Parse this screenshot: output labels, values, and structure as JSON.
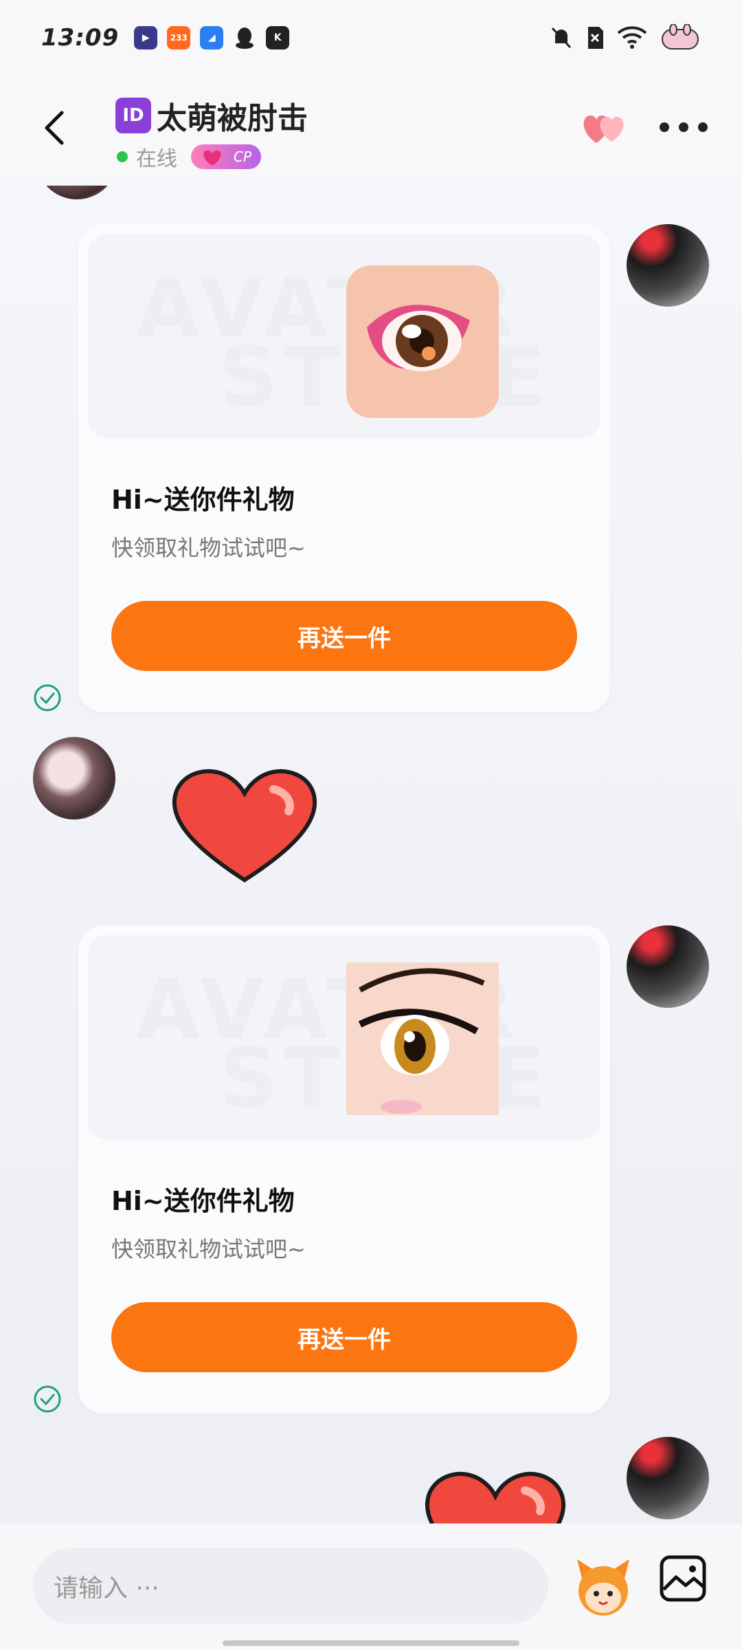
{
  "status": {
    "time": "13:09",
    "apps": [
      {
        "name": "app-icon-1",
        "label": "▶",
        "color": "#3a3a8c"
      },
      {
        "name": "app-icon-2",
        "label": "233",
        "color": "#ff6a1f"
      },
      {
        "name": "app-icon-3",
        "label": "◢",
        "color": "#2b7ff2"
      },
      {
        "name": "qq-icon",
        "label": "",
        "color": "#222"
      },
      {
        "name": "k-app-icon",
        "label": "K",
        "color": "#222"
      }
    ]
  },
  "header": {
    "id_badge": "ID",
    "title": "太萌被肘击",
    "status_text": "在线",
    "cp_label": "CP"
  },
  "messages": [
    {
      "type": "gift-card",
      "title": "Hi~送你件礼物",
      "subtitle": "快领取礼物试试吧~",
      "button": "再送一件",
      "watermark_top": "AVATAR",
      "watermark_bottom": "STORE"
    },
    {
      "type": "gift-card",
      "title": "Hi~送你件礼物",
      "subtitle": "快领取礼物试试吧~",
      "button": "再送一件",
      "watermark_top": "AVATAR",
      "watermark_bottom": "STORE"
    }
  ],
  "input": {
    "placeholder": "请输入 ···"
  },
  "colors": {
    "accent": "#fb7511",
    "online": "#2dc24e",
    "check": "#1aa37a",
    "heart": "#f0483e"
  }
}
